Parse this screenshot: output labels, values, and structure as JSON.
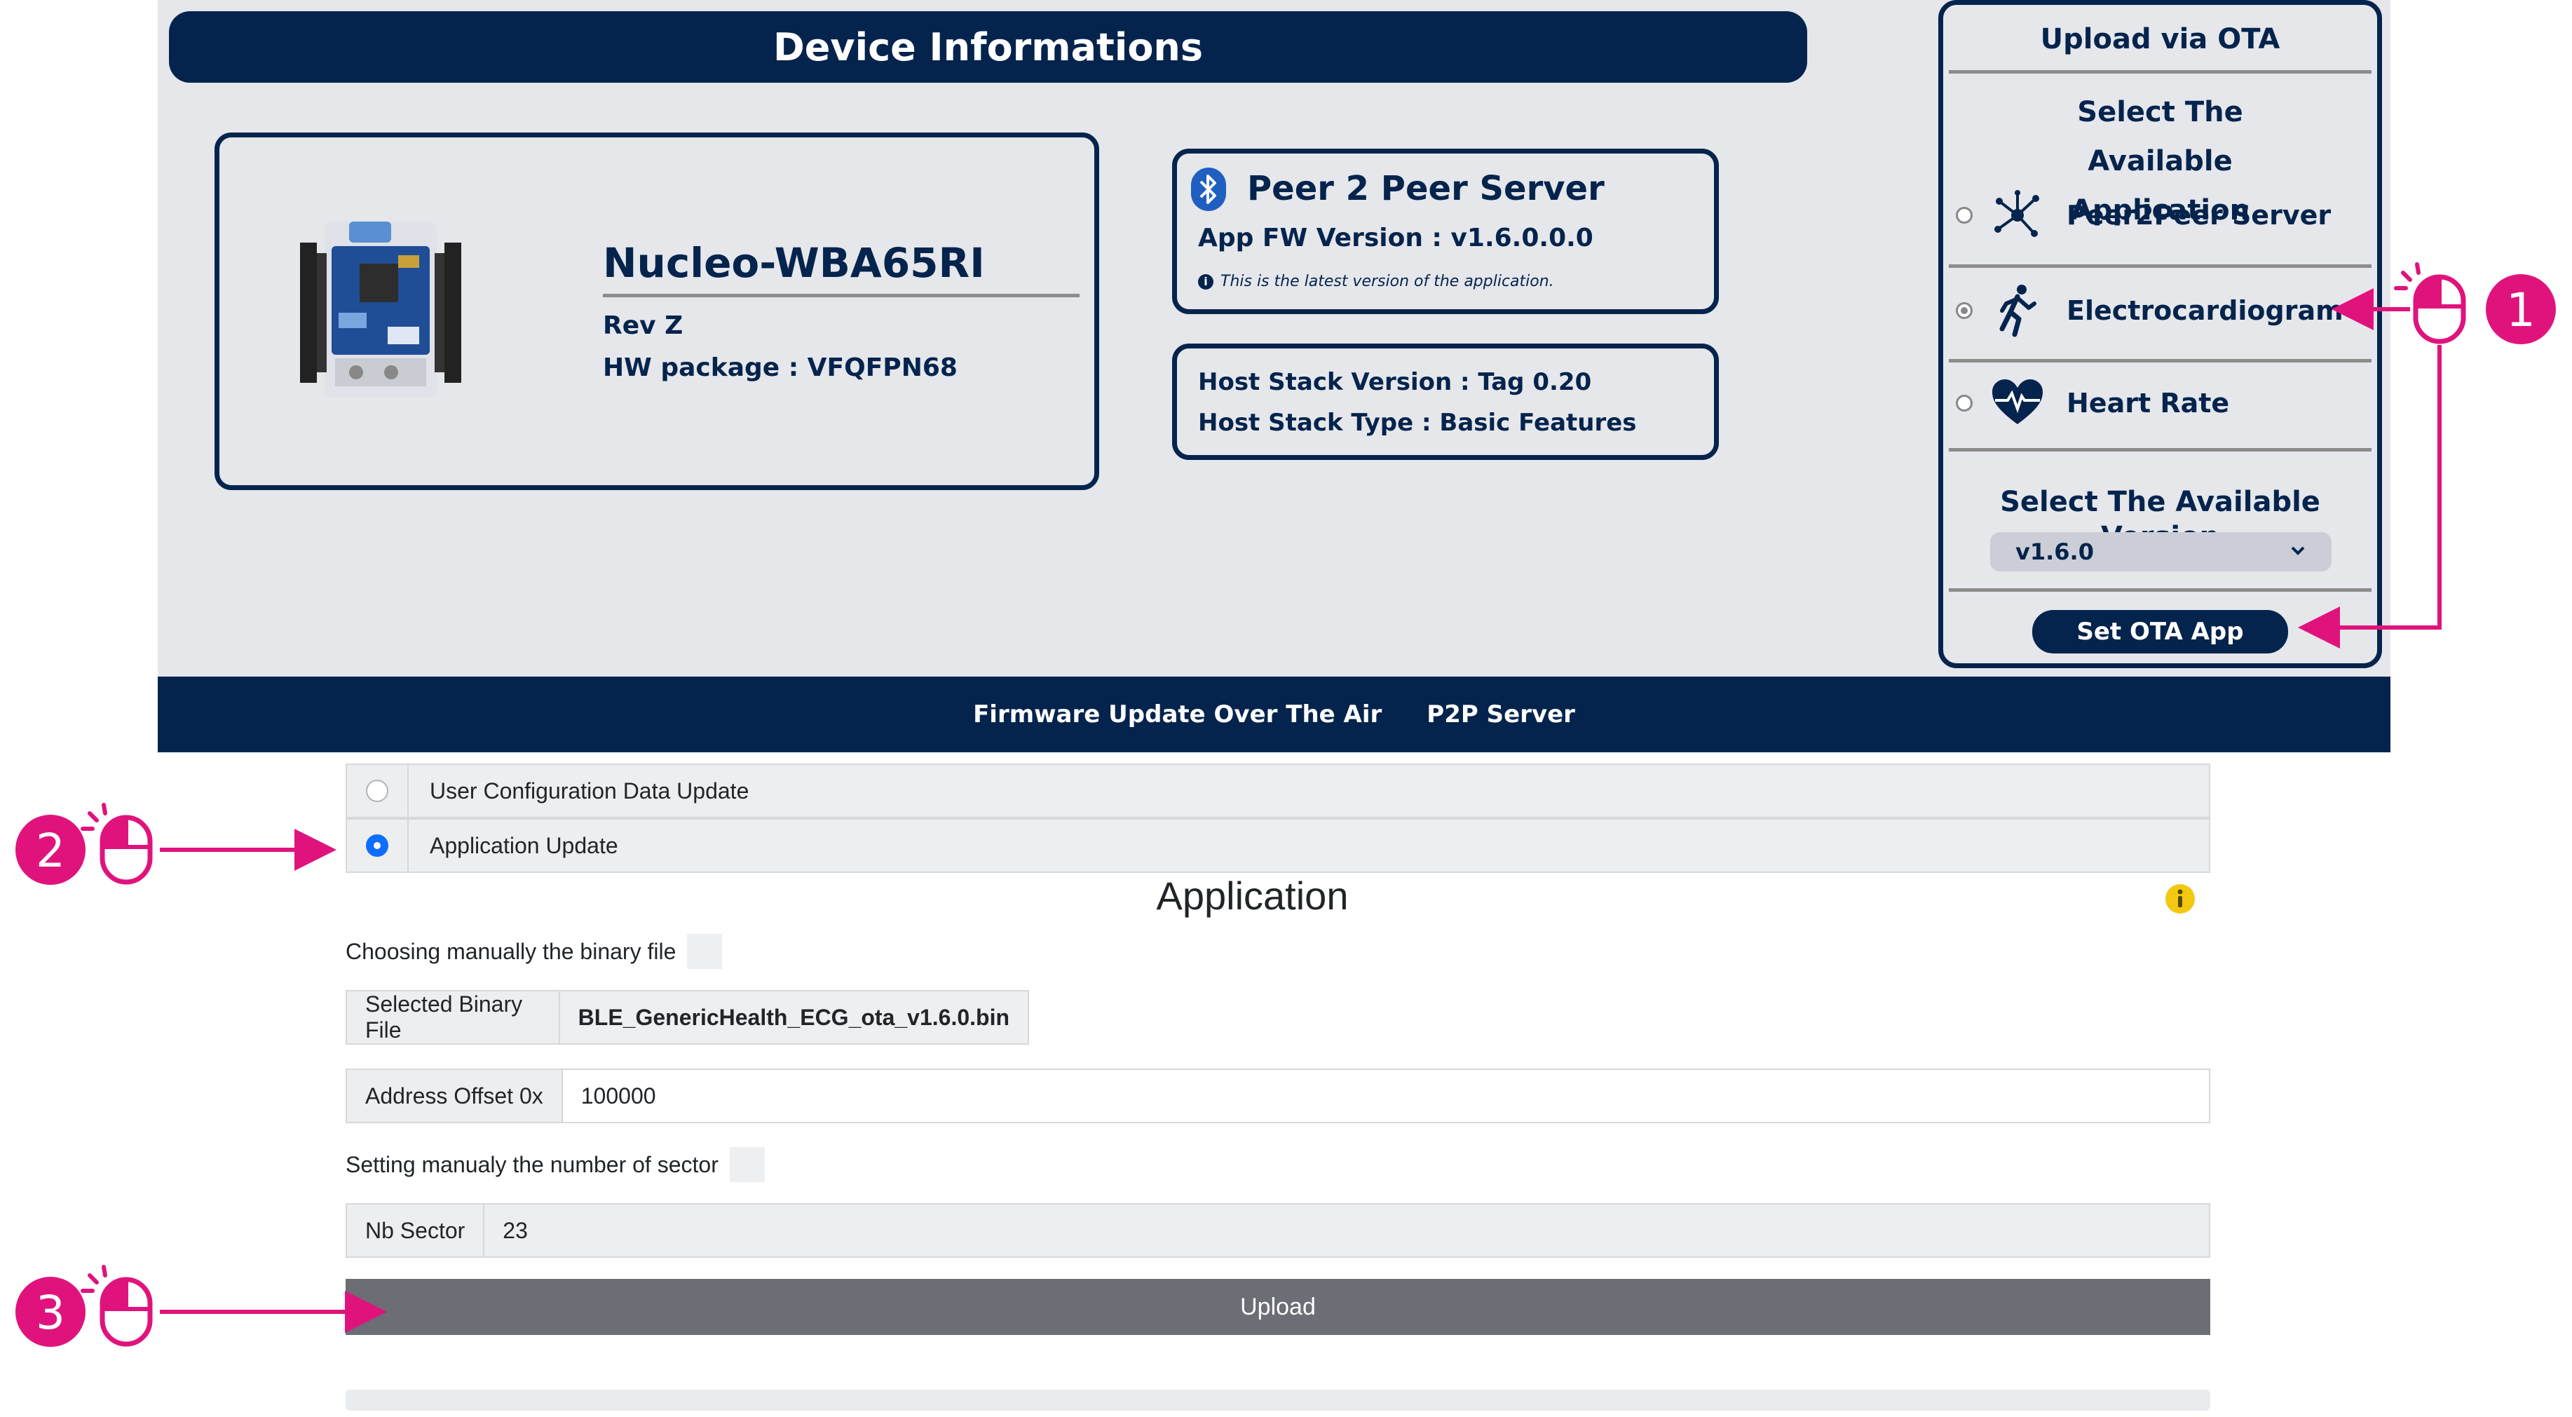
{
  "colors": {
    "navy": "#04244d",
    "panel_bg": "#e6e7eb",
    "callout_pink": "#e0137d",
    "upload_button": "#6c6d75",
    "radio_blue": "#0d6efd",
    "info_yellow": "#f2c811"
  },
  "device_info": {
    "header": "Device Informations",
    "board": {
      "name": "Nucleo-WBA65RI",
      "rev": "Rev Z",
      "hw_package": "HW package : VFQFPN68",
      "image_icon": "nucleo-board-image"
    },
    "app_card": {
      "icon": "bluetooth-icon",
      "title": "Peer 2 Peer Server",
      "fw_version": "App FW Version : v1.6.0.0.0",
      "note": "This is the latest version of the application."
    },
    "stack_card": {
      "version": "Host Stack Version : Tag 0.20",
      "type": "Host Stack Type : Basic Features"
    }
  },
  "ota": {
    "title": "Upload via OTA",
    "select_app_label": "Select The Available Application",
    "apps": [
      {
        "label": "Peer2Peer Server",
        "icon": "network-nodes-icon",
        "selected": false
      },
      {
        "label": "Electrocardiogram",
        "icon": "running-person-icon",
        "selected": true
      },
      {
        "label": "Heart Rate",
        "icon": "heart-pulse-icon",
        "selected": false
      }
    ],
    "select_version_label": "Select The Available Version",
    "version_selected": "v1.6.0",
    "set_button": "Set OTA App"
  },
  "nav": {
    "items": [
      "Firmware Update Over The Air",
      "P2P Server"
    ]
  },
  "update_options": [
    {
      "label": "User Configuration Data Update",
      "selected": false
    },
    {
      "label": "Application Update",
      "selected": true
    }
  ],
  "application": {
    "heading": "Application",
    "choose_manual_label": "Choosing manually the binary file",
    "selected_file_label": "Selected Binary File",
    "selected_file_value": "BLE_GenericHealth_ECG_ota_v1.6.0.bin",
    "address_offset_label": "Address Offset 0x",
    "address_offset_value": "100000",
    "set_sector_label": "Setting manualy the number of sector",
    "nb_sector_label": "Nb Sector",
    "nb_sector_value": "23",
    "upload_button": "Upload"
  },
  "callouts": [
    "1",
    "2",
    "3"
  ]
}
